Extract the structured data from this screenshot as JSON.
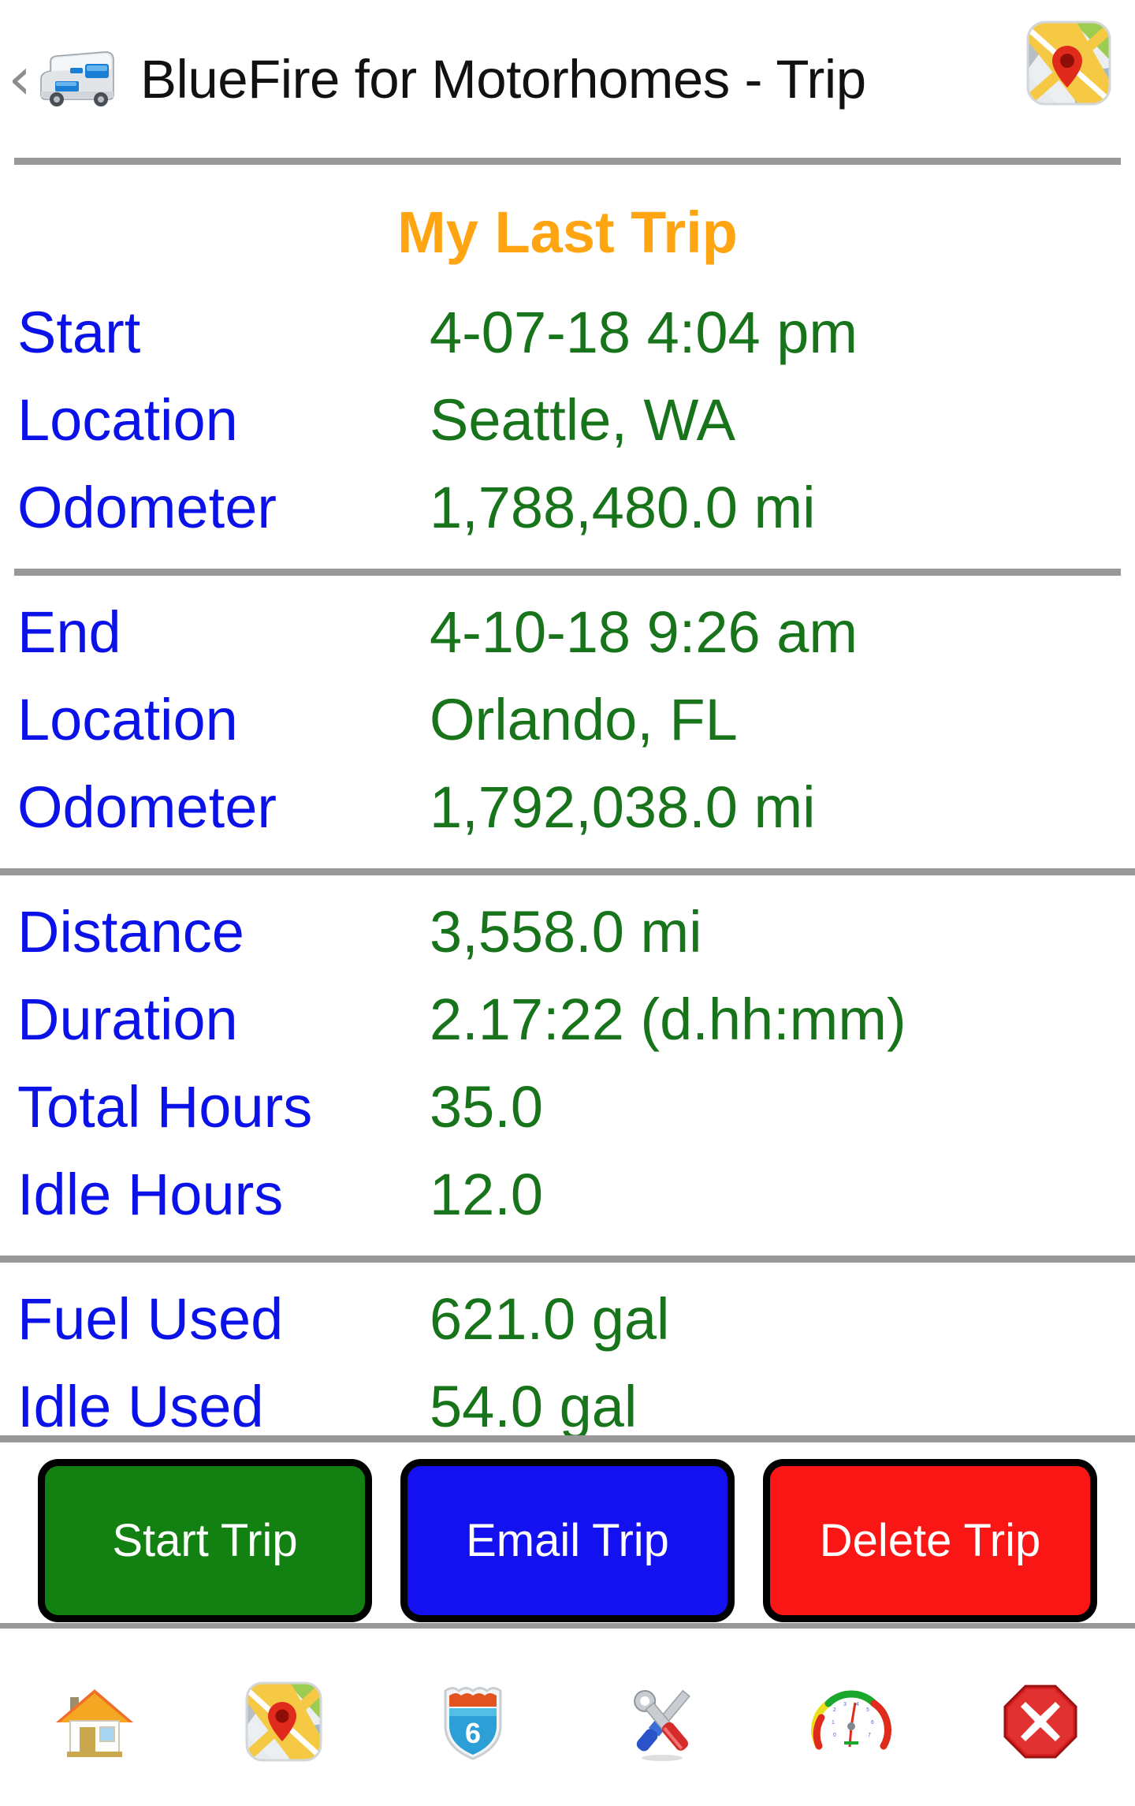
{
  "header": {
    "back_icon": "back-chevron-icon",
    "app_icon": "motorhome-icon",
    "title": "BlueFire for Motorhomes - Trip",
    "right_icon": "map-icon"
  },
  "page_title": "My Last Trip",
  "colors": {
    "label": "#0A12E8",
    "value": "#17741A",
    "title": "#FFA512",
    "rule": "#989898",
    "start_button": "#128112",
    "email_button": "#1411F0",
    "delete_button": "#FB1616"
  },
  "sections": [
    {
      "name": "start-section",
      "rows": [
        {
          "label": "Start",
          "value": "4-07-18 4:04 pm"
        },
        {
          "label": "Location",
          "value": "Seattle, WA"
        },
        {
          "label": "Odometer",
          "value": "1,788,480.0 mi"
        }
      ]
    },
    {
      "name": "end-section",
      "rows": [
        {
          "label": "End",
          "value": "4-10-18 9:26 am"
        },
        {
          "label": "Location",
          "value": "Orlando, FL"
        },
        {
          "label": "Odometer",
          "value": "1,792,038.0 mi"
        }
      ]
    },
    {
      "name": "trip-stats-section",
      "rows": [
        {
          "label": "Distance",
          "value": "3,558.0 mi"
        },
        {
          "label": "Duration",
          "value": "2.17:22 (d.hh:mm)"
        },
        {
          "label": "Total Hours",
          "value": "35.0"
        },
        {
          "label": "Idle Hours",
          "value": "12.0"
        }
      ]
    },
    {
      "name": "fuel-section",
      "rows": [
        {
          "label": "Fuel Used",
          "value": "621.0 gal"
        },
        {
          "label": "Idle Used",
          "value": "54.0 gal"
        }
      ]
    }
  ],
  "buttons": [
    {
      "name": "start-trip-button",
      "label": "Start Trip"
    },
    {
      "name": "email-trip-button",
      "label": "Email Trip"
    },
    {
      "name": "delete-trip-button",
      "label": "Delete Trip"
    }
  ],
  "toolbar": [
    {
      "name": "toolbar-home",
      "icon": "home-icon"
    },
    {
      "name": "toolbar-map",
      "icon": "map-icon"
    },
    {
      "name": "toolbar-highway",
      "icon": "highway-shield-icon",
      "badge": "6"
    },
    {
      "name": "toolbar-tools",
      "icon": "tools-icon"
    },
    {
      "name": "toolbar-gauges",
      "icon": "gauge-icon"
    },
    {
      "name": "toolbar-exit",
      "icon": "exit-icon"
    }
  ]
}
